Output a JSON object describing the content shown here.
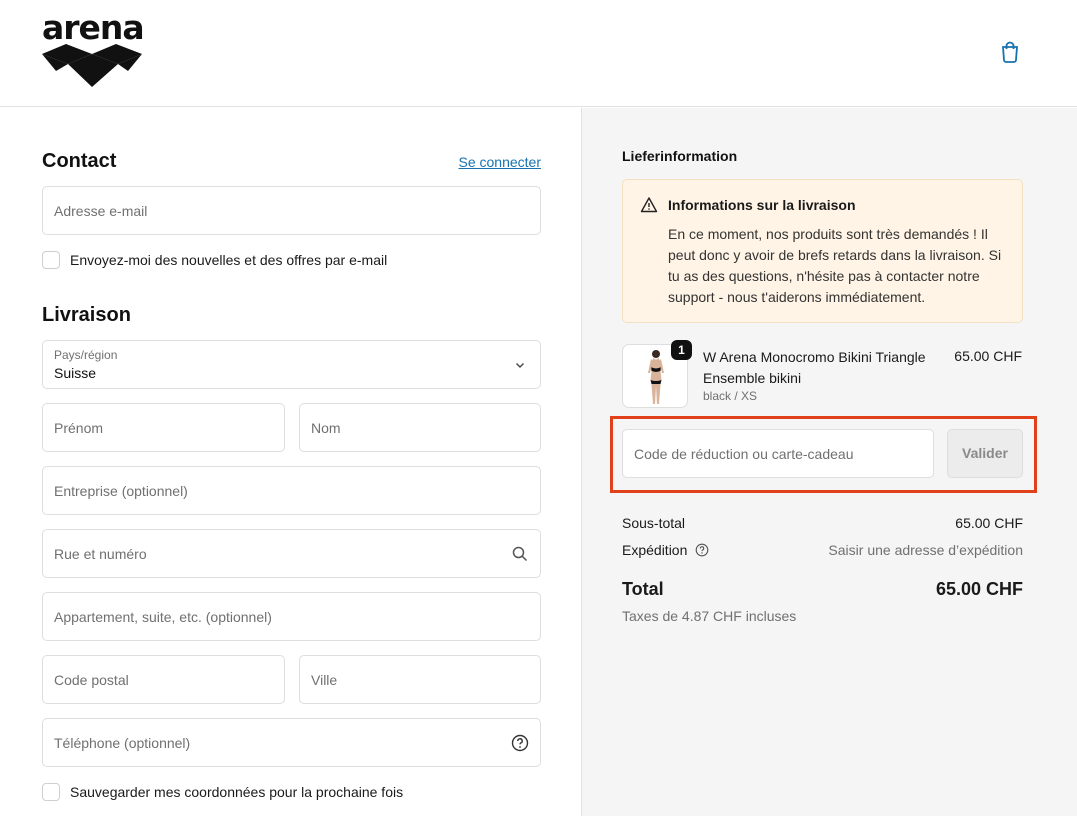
{
  "header": {
    "brand": "arena",
    "cart_icon": "shopping-bag-icon"
  },
  "contact": {
    "title": "Contact",
    "login_link": "Se connecter",
    "email_placeholder": "Adresse e-mail",
    "newsletter_label": "Envoyez-moi des nouvelles et des offres par e-mail"
  },
  "delivery": {
    "title": "Livraison",
    "country_label": "Pays/région",
    "country_value": "Suisse",
    "first_name_placeholder": "Prénom",
    "last_name_placeholder": "Nom",
    "company_placeholder": "Entreprise (optionnel)",
    "street_placeholder": "Rue et numéro",
    "apartment_placeholder": "Appartement, suite, etc. (optionnel)",
    "postal_placeholder": "Code postal",
    "city_placeholder": "Ville",
    "phone_placeholder": "Téléphone (optionnel)",
    "save_label": "Sauvegarder mes coordonnées pour la prochaine fois"
  },
  "summary": {
    "title": "Lieferinformation",
    "notice": {
      "title": "Informations sur la livraison",
      "body": "En ce moment, nos produits sont très demandés ! Il peut donc y avoir de brefs retards dans la livraison. Si tu as des questions, n'hésite pas à contacter notre support - nous t'aiderons immédiatement."
    },
    "product": {
      "quantity": "1",
      "name": "W Arena Monocromo Bikini Triangle Ensemble bikini",
      "variant": "black / XS",
      "price": "65.00 CHF"
    },
    "discount": {
      "placeholder": "Code de réduction ou carte-cadeau",
      "apply_label": "Valider"
    },
    "subtotal_label": "Sous-total",
    "subtotal_value": "65.00 CHF",
    "shipping_label": "Expédition",
    "shipping_value": "Saisir une adresse d’expédition",
    "total_label": "Total",
    "total_value": "65.00 CHF",
    "taxes": "Taxes de 4.87 CHF incluses"
  },
  "colors": {
    "link": "#1773b0",
    "highlight": "#e0401a",
    "notice_bg": "#fff4e5",
    "panel_bg": "#f5f5f5"
  }
}
